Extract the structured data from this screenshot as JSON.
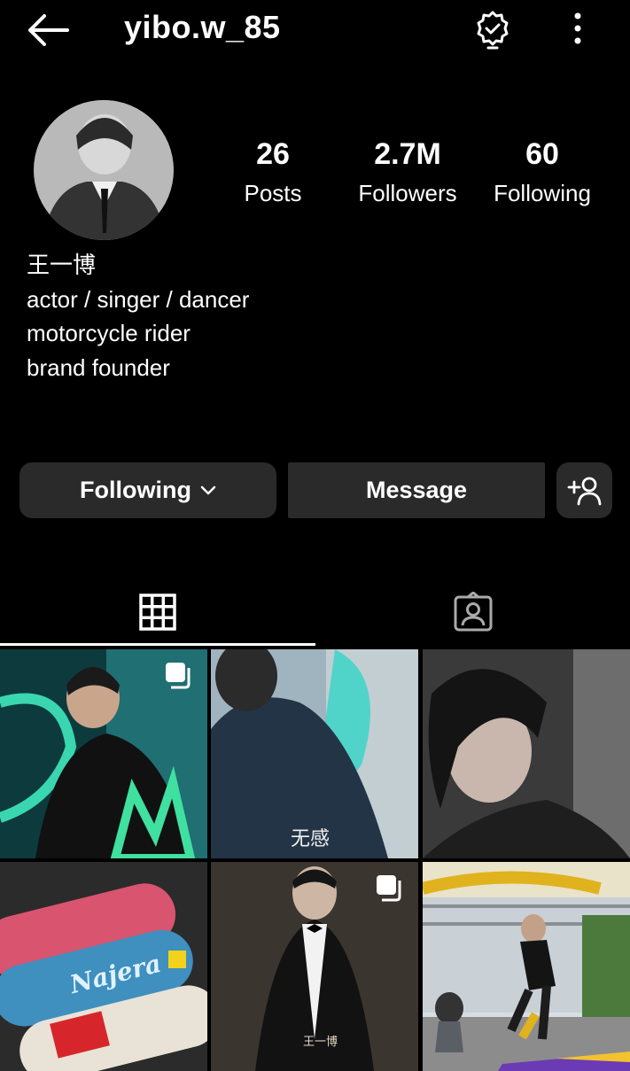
{
  "header": {
    "username": "yibo.w_85",
    "icons": {
      "back": "arrow-left-icon",
      "notifications": "bell-check-icon",
      "more": "more-vertical-icon"
    }
  },
  "profile": {
    "posts": {
      "count": "26",
      "label": "Posts"
    },
    "followers": {
      "count": "2.7M",
      "label": "Followers"
    },
    "following": {
      "count": "60",
      "label": "Following"
    },
    "name": "王一博",
    "bio": [
      "actor / singer / dancer",
      "motorcycle rider",
      "brand founder"
    ]
  },
  "actions": {
    "following_label": "Following",
    "message_label": "Message",
    "add_person_icon": "add-person-icon"
  },
  "tabs": [
    {
      "icon": "grid-icon",
      "active": true
    },
    {
      "icon": "tagged-person-icon",
      "active": false
    }
  ],
  "grid": {
    "posts": [
      {
        "overlay_text": "",
        "multi": true
      },
      {
        "overlay_text": "无感",
        "multi": false
      },
      {
        "overlay_text": "",
        "multi": false
      },
      {
        "overlay_text": "Najera",
        "multi": false
      },
      {
        "overlay_text": "王一博",
        "multi": true
      },
      {
        "overlay_text": "",
        "multi": false
      }
    ]
  },
  "colors": {
    "background": "#000000",
    "button": "#2a2a2a",
    "text": "#ffffff"
  }
}
